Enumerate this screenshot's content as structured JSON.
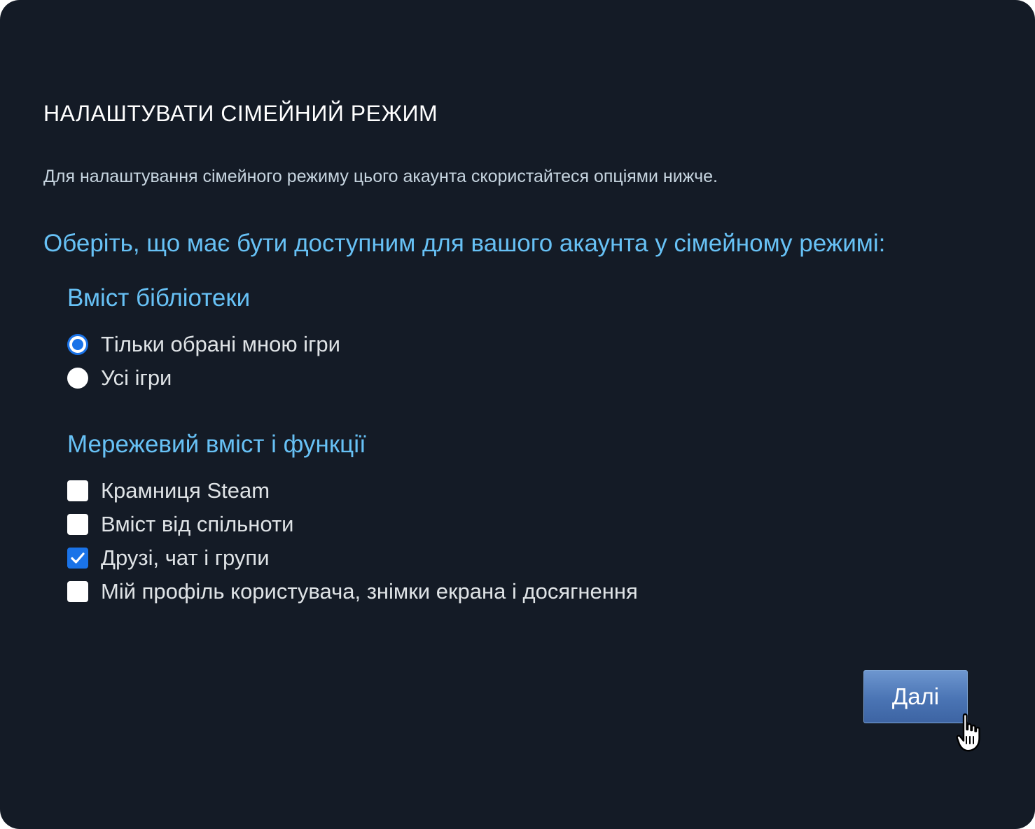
{
  "dialog": {
    "title": "НАЛАШТУВАТИ СІМЕЙНИЙ РЕЖИМ",
    "description": "Для налаштування сімейного режиму цього акаунта скористайтеся опціями нижче.",
    "prompt": "Оберіть, що має бути доступним для вашого акаунта у сімейному режимі:"
  },
  "library": {
    "heading": "Вміст бібліотеки",
    "options": [
      {
        "label": "Тільки обрані мною ігри",
        "selected": true
      },
      {
        "label": "Усі ігри",
        "selected": false
      }
    ]
  },
  "online": {
    "heading": "Мережевий вміст і функції",
    "options": [
      {
        "label": "Крамниця Steam",
        "checked": false
      },
      {
        "label": "Вміст від спільноти",
        "checked": false
      },
      {
        "label": "Друзі, чат і групи",
        "checked": true
      },
      {
        "label": "Мій профіль користувача, знімки екрана і досягнення",
        "checked": false
      }
    ]
  },
  "footer": {
    "next_label": "Далі"
  },
  "colors": {
    "background": "#141b26",
    "accent": "#67c1f5",
    "control_blue": "#1a73e8",
    "button_top": "#6d96cf",
    "button_bottom": "#3d64a3"
  },
  "icons": {
    "cursor": "hand-pointer-icon",
    "check": "checkmark-icon"
  }
}
